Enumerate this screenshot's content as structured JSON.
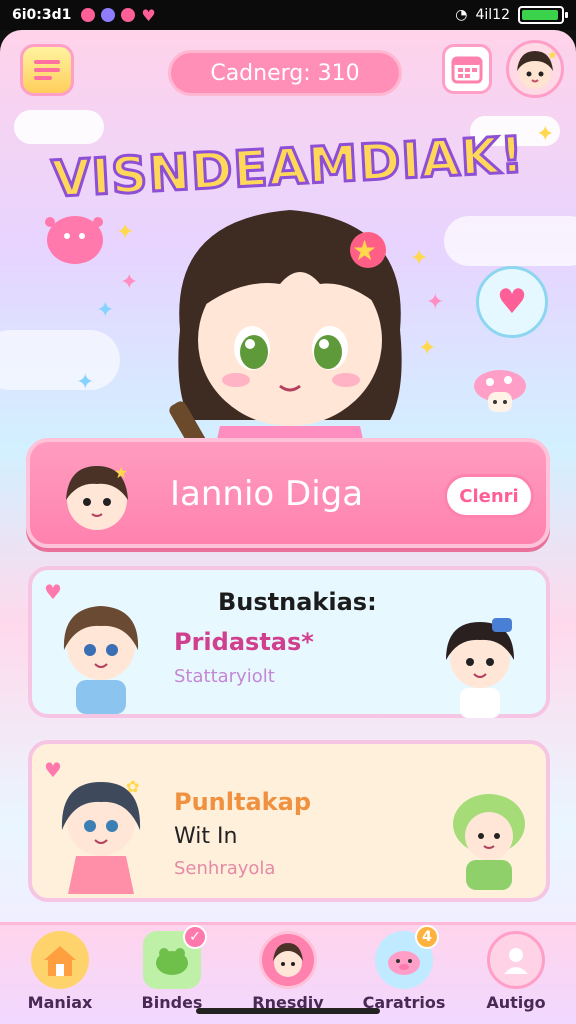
{
  "status_bar": {
    "time": "6i0:3d1",
    "signal": "4il12",
    "battery_level": 0.95
  },
  "header": {
    "title_pill": "Cadnerg: 310",
    "banner_title": "VISNDEAMDIAK!"
  },
  "main_card": {
    "name": "Iannio Diga",
    "button_label": "Clenri"
  },
  "card_blue": {
    "heading": "Bustnakias:",
    "title": "Pridastas*",
    "subtitle": "Stattaryiolt"
  },
  "card_peach": {
    "title": "Punltakap",
    "subtitle": "Wit In",
    "caption": "Senhrayola"
  },
  "bottom_nav": {
    "items": [
      {
        "label": "Maniax",
        "icon": "home-icon"
      },
      {
        "label": "Bindes",
        "icon": "frog-icon",
        "badge": ""
      },
      {
        "label": "Rnesdiy",
        "icon": "avatar-icon"
      },
      {
        "label": "Caratrios",
        "icon": "pig-icon",
        "badge": "4"
      },
      {
        "label": "Autigo",
        "icon": "profile-icon"
      }
    ]
  },
  "colors": {
    "accent_pink": "#ff82ae",
    "title_purple": "#8c4fd6",
    "highlight_yellow": "#ffd85a"
  }
}
